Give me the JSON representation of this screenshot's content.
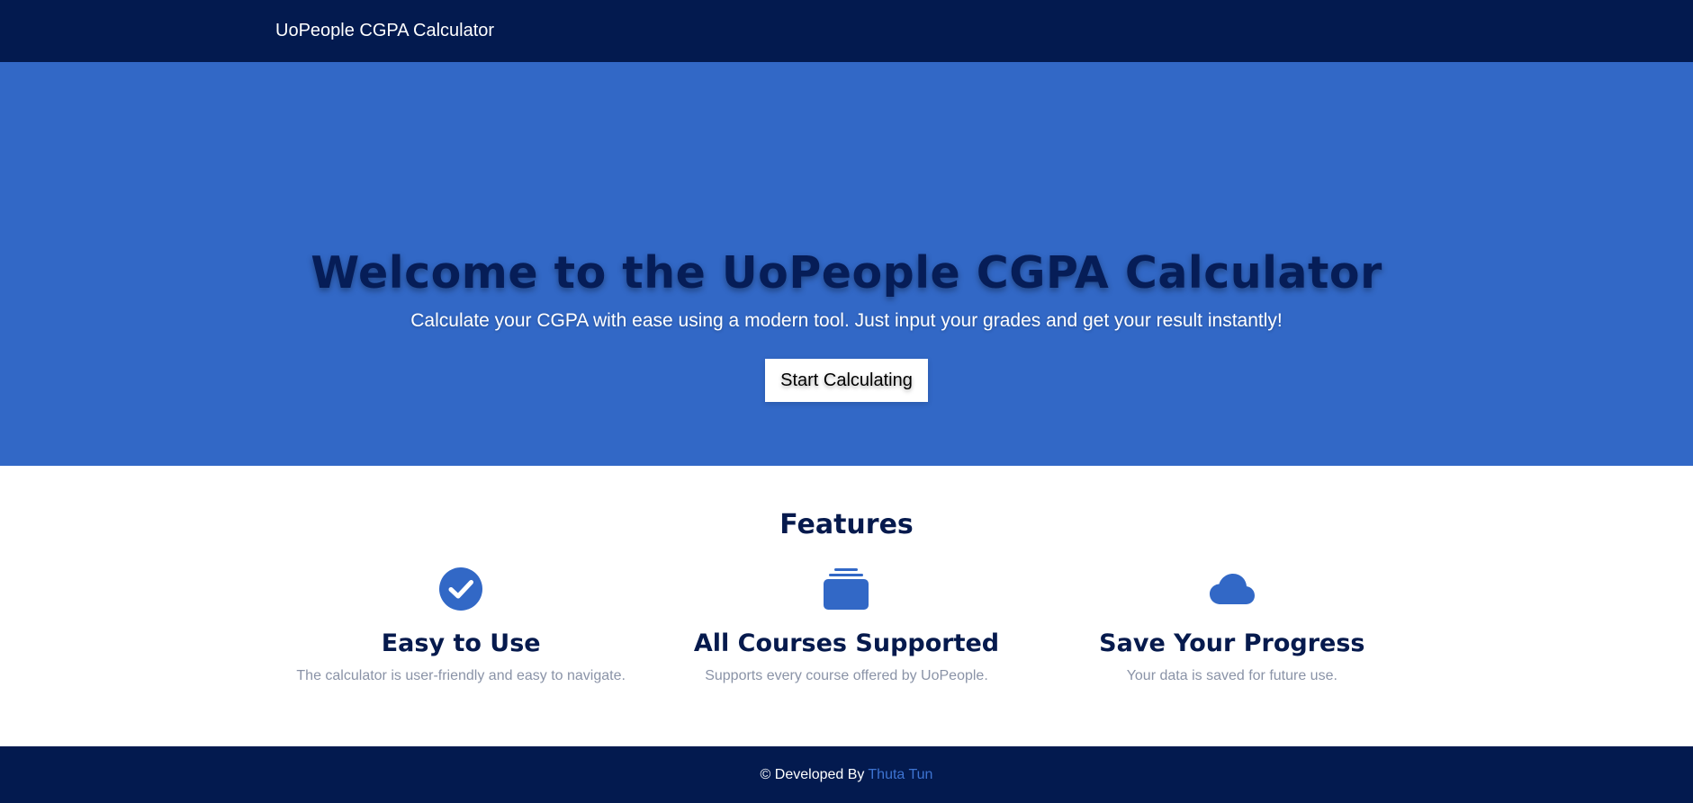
{
  "header": {
    "brand": "UoPeople CGPA Calculator",
    "background": "#031a4f"
  },
  "hero": {
    "title": "Welcome to the UoPeople CGPA Calculator",
    "subtitle": "Calculate your CGPA with ease using a modern tool. Just input your grades and get your result instantly!",
    "cta_label": "Start Calculating",
    "background": "#3268c6"
  },
  "features": {
    "heading": "Features",
    "items": [
      {
        "icon": "check-circle-icon",
        "title": "Easy to Use",
        "description": "The calculator is user-friendly and easy to navigate."
      },
      {
        "icon": "layers-icon",
        "title": "All Courses Supported",
        "description": "Supports every course offered by UoPeople."
      },
      {
        "icon": "cloud-icon",
        "title": "Save Your Progress",
        "description": "Your data is saved for future use."
      }
    ],
    "icon_color": "#3268c6"
  },
  "footer": {
    "prefix": "© Developed By",
    "author": "Thuta Tun",
    "author_color": "#3d73d1"
  }
}
